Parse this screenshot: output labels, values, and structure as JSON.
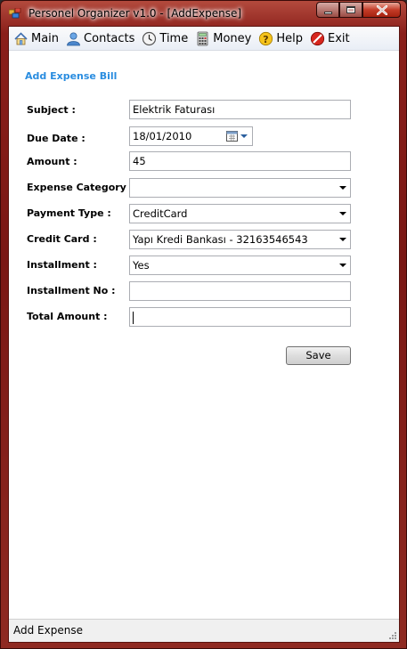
{
  "window": {
    "title": "Personel Organizer v1.0 - [AddExpense]"
  },
  "menu": [
    {
      "label": "Main",
      "icon": "home-icon"
    },
    {
      "label": "Contacts",
      "icon": "contacts-icon"
    },
    {
      "label": "Time",
      "icon": "clock-icon"
    },
    {
      "label": "Money",
      "icon": "calculator-icon"
    },
    {
      "label": "Help",
      "icon": "help-icon"
    },
    {
      "label": "Exit",
      "icon": "exit-icon"
    }
  ],
  "form": {
    "title": "Add Expense Bill",
    "subject": {
      "label": "Subject :",
      "value": "Elektrik Faturası"
    },
    "due_date": {
      "label": "Due Date :",
      "value": "18/01/2010"
    },
    "amount": {
      "label": "Amount :",
      "value": "45"
    },
    "expense_category": {
      "label": "Expense Category :",
      "value": ""
    },
    "payment_type": {
      "label": "Payment Type :",
      "value": "CreditCard"
    },
    "credit_card": {
      "label": "Credit Card :",
      "value": "Yapı Kredi Bankası - 32163546543"
    },
    "installment": {
      "label": "Installment :",
      "value": "Yes"
    },
    "installment_no": {
      "label": "Installment No :",
      "value": ""
    },
    "total_amount": {
      "label": "Total Amount :",
      "value": ""
    },
    "save_label": "Save"
  },
  "status": {
    "text": "Add Expense"
  },
  "colors": {
    "accent": "#2a8de0",
    "titlebar": "#8a1f1a"
  }
}
